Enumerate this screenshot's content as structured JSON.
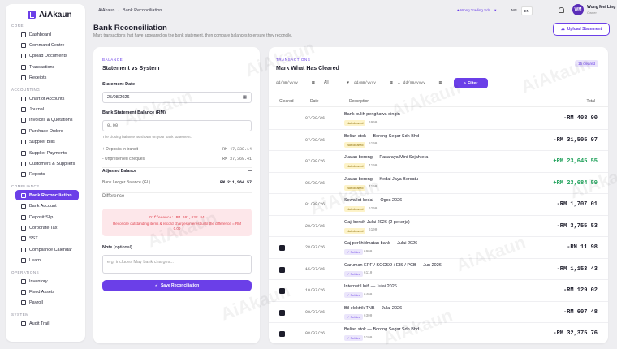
{
  "brand": {
    "name": "AiAkaun"
  },
  "sidebar": {
    "sections": [
      {
        "title": "CORE",
        "items": [
          "Dashboard",
          "Command Centre",
          "Upload Documents",
          "Transactions",
          "Receipts"
        ]
      },
      {
        "title": "ACCOUNTING",
        "items": [
          "Chart of Accounts",
          "Journal",
          "Invoices & Quotations",
          "Purchase Orders",
          "Supplier Bills",
          "Supplier Payments",
          "Customers & Suppliers",
          "Reports"
        ]
      },
      {
        "title": "COMPLIANCE",
        "items": [
          "Bank Reconciliation",
          "Bank Account",
          "Deposit Slip",
          "Corporate Tax",
          "SST",
          "Compliance Calendar",
          "Learn"
        ]
      },
      {
        "title": "OPERATIONS",
        "items": [
          "Inventory",
          "Fixed Assets",
          "Payroll"
        ]
      },
      {
        "title": "SYSTEM",
        "items": [
          "Audit Trail"
        ]
      }
    ],
    "active": "Bank Reconciliation"
  },
  "topbar": {
    "breadcrumb": [
      "AiAkaun",
      "Bank Reconciliation"
    ],
    "company": "Wong Trading Sdn...",
    "lang": [
      "MS",
      "EN"
    ],
    "lang_active": "EN",
    "user_initials": "WM",
    "user_name": "Wong Mei Ling",
    "user_role": "Owner"
  },
  "page": {
    "title": "Bank Reconciliation",
    "subtitle": "Mark transactions that have appeared on the bank statement, then compare balances to ensure they reconcile.",
    "upload_button": "Upload Statement"
  },
  "balance": {
    "overline": "BALANCE",
    "title": "Statement vs System",
    "statement_date_label": "Statement Date",
    "statement_date": "25/08/2026",
    "statement_balance_label": "Bank Statement Balance (RM)",
    "statement_balance": "0.00",
    "hint": "The closing balance as shown on your bank statement.",
    "deposits_label": "+ Deposits in transit",
    "deposits_value": "RM 47,338.14",
    "cheques_label": "- Unpresented cheques",
    "cheques_value": "RM 37,369.41",
    "adjusted_label": "Adjusted Balance",
    "adjusted_value": "—",
    "ledger_label": "Bank Ledger Balance (GL)",
    "ledger_value": "RM 211,964.57",
    "difference_label": "Difference",
    "difference_value": "—",
    "diff_amount": "Difference: RM 201,832.84",
    "diff_message": "Reconcile outstanding items & record charges/interest until the difference = RM 0.00",
    "note_label": "Note",
    "note_optional": "(optional)",
    "note_placeholder": "e.g. includes May bank charges...",
    "save_button": "Save Reconciliation"
  },
  "transactions": {
    "overline": "TRANSACTIONS",
    "title": "Mark What Has Cleared",
    "cleared_badge": "15 cleared",
    "filter_from": "dd/mm/yyyy",
    "filter_status": "All",
    "filter_date1": "dd/mm/yyyy",
    "filter_date2": "dd/mm/yyyy",
    "filter_button": "Filter",
    "columns": [
      "Cleared",
      "Date",
      "Description",
      "Total"
    ],
    "rows": [
      {
        "cleared": false,
        "date": "07/08/26",
        "desc": "Bank pulih penghawa dingin",
        "status": "Not cleared",
        "ref": "6990",
        "amount": "-RM 408.90",
        "positive": false
      },
      {
        "cleared": false,
        "date": "07/08/26",
        "desc": "Belian stok — Borong Segar Sdn Bhd",
        "status": "Not cleared",
        "ref": "5100",
        "amount": "-RM 31,505.97",
        "positive": false
      },
      {
        "cleared": false,
        "date": "07/08/26",
        "desc": "Jualan borong — Pasaraya Mini Sejahtera",
        "status": "Not cleared",
        "ref": "4100",
        "amount": "+RM 23,645.55",
        "positive": true
      },
      {
        "cleared": false,
        "date": "05/08/26",
        "desc": "Jualan borong — Kedai Jaya Bersatu",
        "status": "Not cleared",
        "ref": "4100",
        "amount": "+RM 23,684.59",
        "positive": true
      },
      {
        "cleared": false,
        "date": "01/08/26",
        "desc": "Sewa lot kedai — Ogos 2026",
        "status": "Not cleared",
        "ref": "6200",
        "amount": "-RM 1,707.01",
        "positive": false
      },
      {
        "cleared": false,
        "date": "28/07/26",
        "desc": "Gaji bersih Julai 2026 (2 pekerja)",
        "status": "Not cleared",
        "ref": "6100",
        "amount": "-RM 3,755.53",
        "positive": false
      },
      {
        "cleared": true,
        "date": "28/07/26",
        "desc": "Caj perkhidmatan bank — Julai 2026",
        "status": "✓ Settled",
        "ref": "6900",
        "amount": "-RM 11.98",
        "positive": false
      },
      {
        "cleared": true,
        "date": "15/07/26",
        "desc": "Caruman EPF / SOCSO / EIS / PCB — Jun 2026",
        "status": "✓ Settled",
        "ref": "6110",
        "amount": "-RM 1,153.43",
        "positive": false
      },
      {
        "cleared": true,
        "date": "10/07/26",
        "desc": "Internet Unifi — Julai 2026",
        "status": "✓ Settled",
        "ref": "6400",
        "amount": "-RM 129.02",
        "positive": false
      },
      {
        "cleared": true,
        "date": "08/07/26",
        "desc": "Bil elektrik TNB — Julai 2026",
        "status": "✓ Settled",
        "ref": "6300",
        "amount": "-RM 607.48",
        "positive": false
      },
      {
        "cleared": true,
        "date": "08/07/26",
        "desc": "Belian stok — Borong Segar Sdn Bhd",
        "status": "✓ Settled",
        "ref": "5100",
        "amount": "-RM 32,375.76",
        "positive": false
      }
    ]
  },
  "watermark": "AiAkaun"
}
